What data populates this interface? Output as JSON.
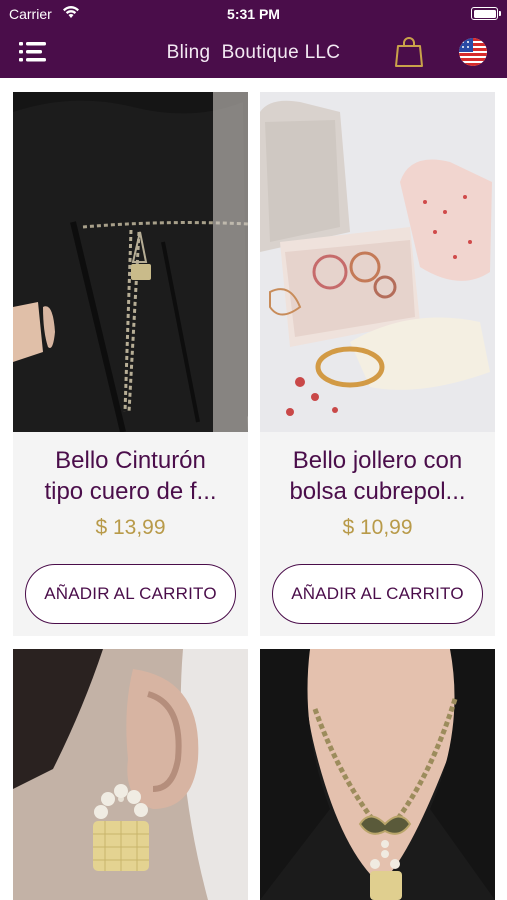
{
  "status_bar": {
    "carrier": "Carrier",
    "time": "5:31 PM"
  },
  "header": {
    "title": "Bling  Boutique LLC",
    "menu_icon": "hamburger-menu-icon",
    "cart_icon": "shopping-bag-icon",
    "language_icon": "us-flag-icon"
  },
  "colors": {
    "header_bg": "#4a0d4a",
    "accent_text": "#4a0d4a",
    "price": "#b89a49",
    "card_bg": "#f4f4f4"
  },
  "products": [
    {
      "name_line1": "Bello Cinturón",
      "name_line2": "tipo cuero de f...",
      "price": "$ 13,99",
      "button": "AÑADIR AL CARRITO",
      "image": "black-coat-with-chain-belt"
    },
    {
      "name_line1": "Bello jollero con",
      "name_line2": "bolsa cubrepol...",
      "price": "$ 10,99",
      "button": "AÑADIR AL CARRITO",
      "image": "jewelry-box-with-bracelets"
    },
    {
      "name_line1": "",
      "name_line2": "",
      "price": "",
      "button": "",
      "image": "pearl-bag-earring"
    },
    {
      "name_line1": "",
      "name_line2": "",
      "price": "",
      "button": "",
      "image": "chain-bow-necklace"
    }
  ]
}
